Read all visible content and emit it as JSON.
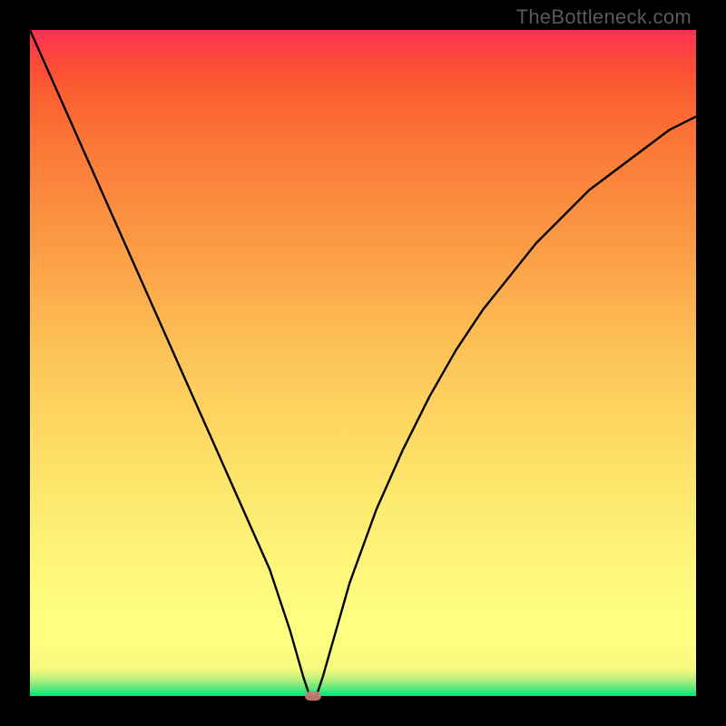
{
  "watermark": "TheBottleneck.com",
  "colors": {
    "frame": "#000000",
    "curve": "#000000",
    "marker": "#cb7f76",
    "gradient_top": "#ff3256",
    "gradient_mid": "#fdd561",
    "gradient_bottom": "#00e47a"
  },
  "chart_data": {
    "type": "line",
    "title": "",
    "xlabel": "",
    "ylabel": "",
    "xlim": [
      0,
      100
    ],
    "ylim": [
      0,
      100
    ],
    "grid": false,
    "legend": false,
    "series": [
      {
        "name": "bottleneck-curve",
        "x": [
          0,
          4,
          8,
          12,
          16,
          20,
          24,
          28,
          32,
          36,
          39,
          41,
          42,
          43,
          44,
          46,
          48,
          52,
          56,
          60,
          64,
          68,
          72,
          76,
          80,
          84,
          88,
          92,
          96,
          100
        ],
        "y": [
          100,
          91,
          82,
          73,
          64,
          55,
          46,
          37,
          28,
          19,
          10,
          3,
          0,
          0,
          3,
          10,
          17,
          28,
          37,
          45,
          52,
          58,
          63,
          68,
          72,
          76,
          79,
          82,
          85,
          87
        ]
      }
    ],
    "marker": {
      "x": 42.5,
      "y": 0
    }
  }
}
